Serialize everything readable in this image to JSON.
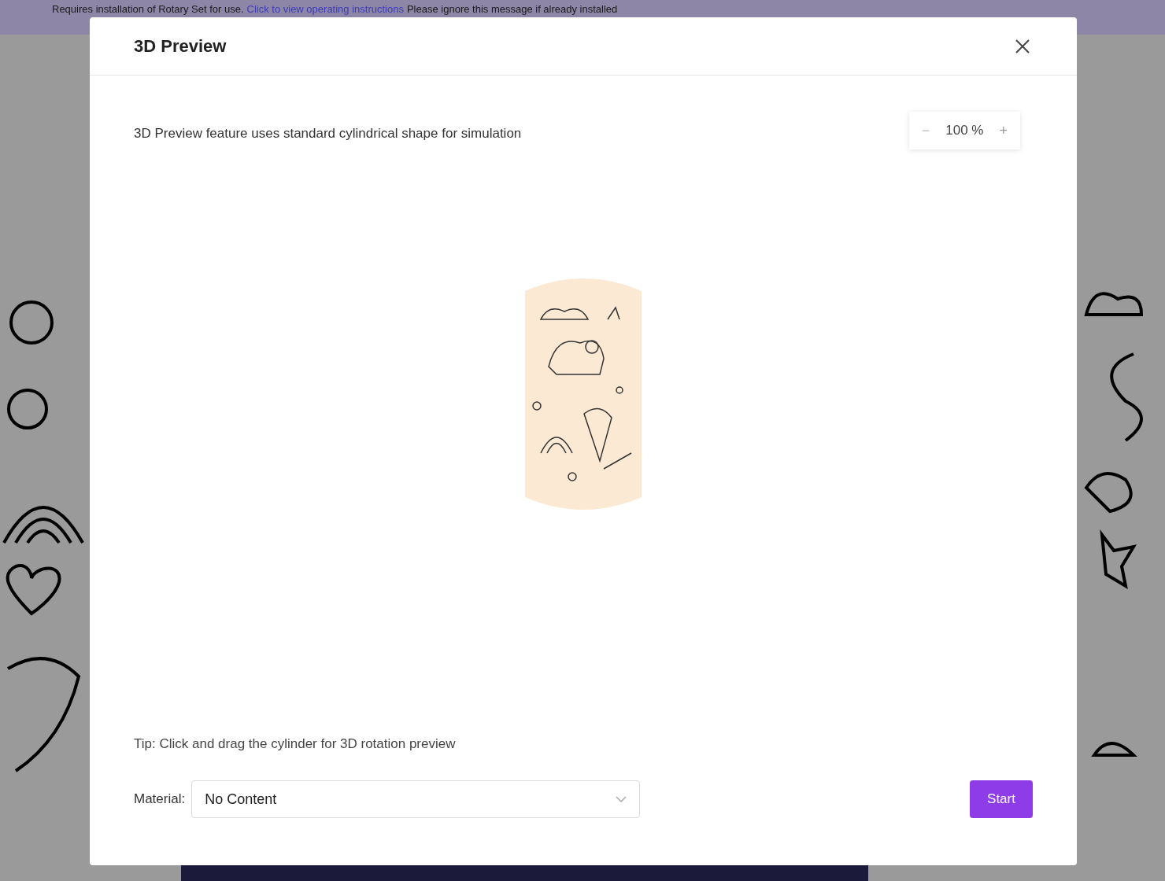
{
  "banner": {
    "text": "Requires installation of Rotary Set for use.",
    "link": "Click to view operating instructions",
    "note": "Please ignore this message if already installed"
  },
  "dialog": {
    "title": "3D Preview",
    "description": "3D Preview feature uses standard cylindrical shape for simulation",
    "zoom": {
      "value": "100 %",
      "minus": "−",
      "plus": "+"
    },
    "tip": "Tip: Click and drag the cylinder for 3D rotation preview",
    "material": {
      "label": "Material:",
      "value": "No Content"
    },
    "start_button": "Start"
  }
}
